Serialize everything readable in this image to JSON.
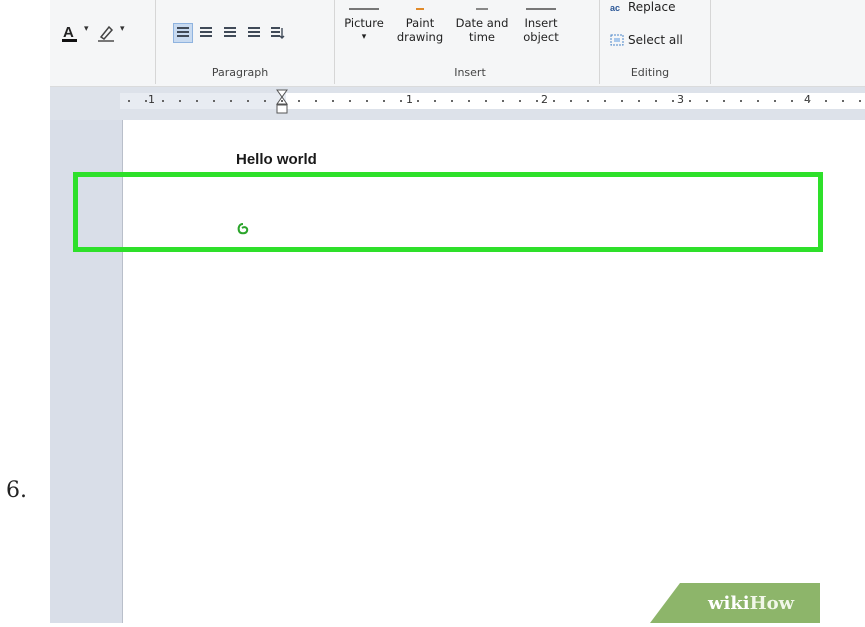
{
  "step_number": "6.",
  "ribbon": {
    "font_icons": [
      "font-color-icon",
      "highlight-icon"
    ],
    "paragraph": {
      "label": "Paragraph"
    },
    "insert": {
      "label": "Insert",
      "picture": "Picture",
      "paint_line1": "Paint",
      "paint_line2": "drawing",
      "datetime_line1": "Date and",
      "datetime_line2": "time",
      "object_line1": "Insert",
      "object_line2": "object"
    },
    "editing": {
      "label": "Editing",
      "replace": "Replace",
      "select_all": "Select all"
    }
  },
  "ruler": {
    "numbers": [
      "1",
      "1",
      "2",
      "3",
      "4"
    ]
  },
  "document": {
    "text": "Hello world"
  },
  "watermark": {
    "wiki": "wiki",
    "how": "How"
  },
  "colors": {
    "highlight": "#2ee02a",
    "ribbon_bg": "#f5f6f7",
    "watermark_bg": "#8db56a"
  }
}
